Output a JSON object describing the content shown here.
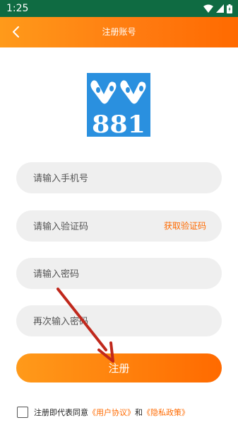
{
  "status_bar": {
    "time": "1:25"
  },
  "app_bar": {
    "title": "注册账号"
  },
  "logo": {
    "text": "881",
    "bg_color": "#2a90df"
  },
  "form": {
    "phone_placeholder": "请输入手机号",
    "code_placeholder": "请输入验证码",
    "get_code_label": "获取验证码",
    "password_placeholder": "请输入密码",
    "confirm_password_placeholder": "再次输入密码"
  },
  "submit_label": "注册",
  "agreement": {
    "prefix": "注册即代表同意",
    "user_agreement": "《用户协议》",
    "conjunction": "和",
    "privacy_policy": "《隐私政策》"
  },
  "colors": {
    "accent": "#ff7a10",
    "status_bar": "#0f6b42",
    "annotation_arrow": "#c0281c"
  }
}
